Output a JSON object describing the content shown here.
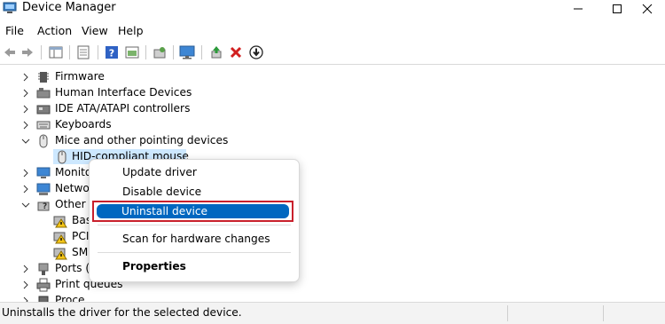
{
  "window": {
    "title": "Device Manager"
  },
  "menu": [
    "File",
    "Action",
    "View",
    "Help"
  ],
  "tree": [
    {
      "label": "Firmware",
      "icon": "firmware-icon",
      "expanded": false
    },
    {
      "label": "Human Interface Devices",
      "icon": "hid-icon",
      "expanded": false
    },
    {
      "label": "IDE ATA/ATAPI controllers",
      "icon": "ide-controller-icon",
      "expanded": false
    },
    {
      "label": "Keyboards",
      "icon": "keyboard-icon",
      "expanded": false
    },
    {
      "label": "Mice and other pointing devices",
      "icon": "mouse-icon",
      "expanded": true
    },
    {
      "label": "HID-compliant mouse",
      "icon": "mouse-icon",
      "selected": true
    },
    {
      "label": "Monito",
      "icon": "monitor-icon",
      "expanded": false
    },
    {
      "label": "Netwo",
      "icon": "network-adapter-icon",
      "expanded": false
    },
    {
      "label": "Other d",
      "icon": "other-devices-icon",
      "expanded": true
    },
    {
      "label": "Bas",
      "icon": "warning-device-icon"
    },
    {
      "label": "PCI",
      "icon": "warning-device-icon"
    },
    {
      "label": "SM",
      "icon": "warning-device-icon"
    },
    {
      "label": "Ports (C",
      "icon": "port-icon",
      "expanded": false
    },
    {
      "label": "Print queues",
      "icon": "printer-icon",
      "expanded": false
    },
    {
      "label": "Proce",
      "icon": "processor-icon",
      "expanded": false
    }
  ],
  "context_menu": {
    "update_driver": "Update driver",
    "disable_device": "Disable device",
    "uninstall_device": "Uninstall device",
    "scan_hardware": "Scan for hardware changes",
    "properties": "Properties"
  },
  "status": {
    "text": "Uninstalls the driver for the selected device."
  },
  "colors": {
    "highlight": "#0067c0",
    "annotation_box": "#c9202c",
    "selection": "#cde8ff"
  }
}
